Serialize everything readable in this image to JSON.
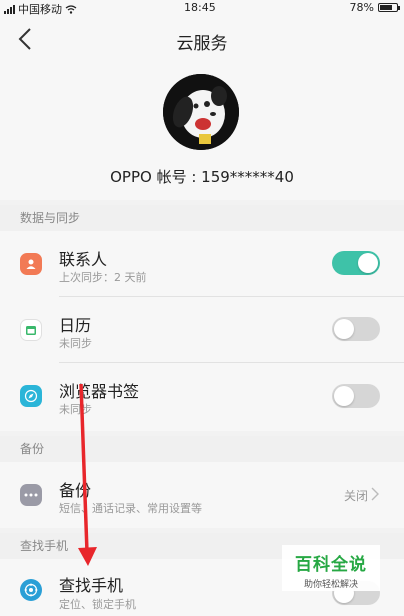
{
  "status": {
    "carrier": "中国移动",
    "time": "18:45",
    "battery": "78%",
    "battery_level": 0.78
  },
  "header": {
    "title": "云服务"
  },
  "profile": {
    "account_label": "OPPO 帐号 : 159******40"
  },
  "sections": {
    "sync": "数据与同步",
    "backup": "备份",
    "find": "查找手机"
  },
  "sync_items": [
    {
      "title": "联系人",
      "subtitle": "上次同步：2 天前",
      "toggle": "on",
      "icon": "contacts-icon",
      "color": "#f27a55"
    },
    {
      "title": "日历",
      "subtitle": "未同步",
      "toggle": "off",
      "icon": "calendar-icon",
      "color": "#39b86b"
    },
    {
      "title": "浏览器书签",
      "subtitle": "未同步",
      "toggle": "off",
      "icon": "compass-icon",
      "color": "#2bb5d8"
    }
  ],
  "backup_item": {
    "title": "备份",
    "subtitle": "短信、通话记录、常用设置等",
    "value": "关闭",
    "icon": "more-dots-icon",
    "color": "#9a9aa6"
  },
  "find_item": {
    "title": "查找手机",
    "subtitle": "定位、锁定手机",
    "icon": "find-phone-icon",
    "color": "#2a9fd6"
  },
  "watermark": {
    "main": "百科全说",
    "sub": "助你轻松解决"
  },
  "colors": {
    "accent": "#3ec2a8",
    "annotation_arrow": "#e8262b"
  }
}
